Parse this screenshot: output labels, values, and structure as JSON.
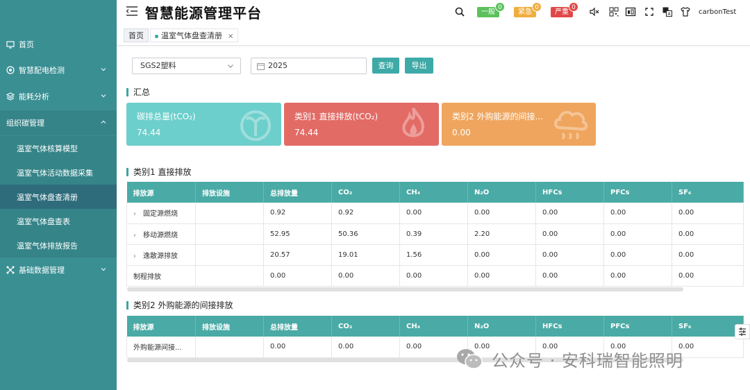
{
  "app": {
    "title": "智慧能源管理平台"
  },
  "sidebar": {
    "items": [
      {
        "label": "首页",
        "icon": "monitor-icon"
      },
      {
        "label": "智慧配电检测",
        "icon": "target-icon"
      },
      {
        "label": "能耗分析",
        "icon": "layers-icon"
      },
      {
        "label": "组织碳管理",
        "icon": ""
      },
      {
        "label": "基础数据管理",
        "icon": "network-icon"
      }
    ],
    "sub_items": [
      {
        "label": "温室气体核算模型"
      },
      {
        "label": "温室气体活动数据采集"
      },
      {
        "label": "温室气体盘查清册"
      },
      {
        "label": "温室气体盘查表"
      },
      {
        "label": "温室气体排放报告"
      }
    ]
  },
  "header": {
    "alerts": [
      {
        "label": "一般",
        "count": "0",
        "color": "#5cc15c"
      },
      {
        "label": "紧急",
        "count": "0",
        "color": "#f0ad3e"
      },
      {
        "label": "严重",
        "count": "0",
        "color": "#e04848"
      }
    ],
    "username": "carbonTest"
  },
  "tabs": [
    {
      "label": "首页"
    },
    {
      "label": "温室气体盘查清册",
      "close": "×"
    }
  ],
  "filters": {
    "org_value": "SGS2塑料",
    "year_value": "2025",
    "query_label": "查询",
    "export_label": "导出"
  },
  "summary": {
    "heading": "汇总",
    "cards": [
      {
        "title": "碳排总量(tCO₂)",
        "value": "74.44",
        "color": "#6dcfcb"
      },
      {
        "title": "类别1 直接排放(tCO₂)",
        "value": "74.44",
        "color": "#e36b66"
      },
      {
        "title": "类别2 外购能源的间接...",
        "value": "0.00",
        "color": "#efa55e"
      }
    ]
  },
  "cat1": {
    "heading": "类别1 直接排放",
    "headers": [
      "排放源",
      "排放设施",
      "总排放量",
      "CO₂",
      "CH₄",
      "N₂O",
      "HFCs",
      "PFCs",
      "SF₆"
    ],
    "rows": [
      {
        "cells": [
          "固定源燃烧",
          "",
          "0.92",
          "0.92",
          "0.00",
          "0.00",
          "0.00",
          "0.00",
          "0.00"
        ],
        "expandable": true
      },
      {
        "cells": [
          "移动源燃烧",
          "",
          "52.95",
          "50.36",
          "0.39",
          "2.20",
          "0.00",
          "0.00",
          "0.00"
        ],
        "expandable": true
      },
      {
        "cells": [
          "逸散源排放",
          "",
          "20.57",
          "19.01",
          "1.56",
          "0.00",
          "0.00",
          "0.00",
          "0.00"
        ],
        "expandable": true
      },
      {
        "cells": [
          "制程排放",
          "",
          "0.00",
          "0.00",
          "0.00",
          "0.00",
          "0.00",
          "0.00",
          "0.00"
        ],
        "expandable": false
      }
    ]
  },
  "cat2": {
    "heading": "类别2 外购能源的间接排放",
    "headers": [
      "排放源",
      "排放设施",
      "总排放量",
      "CO₂",
      "CH₄",
      "N₂O",
      "HFCs",
      "PFCs",
      "SF₆"
    ],
    "rows": [
      {
        "cells": [
          "外购能源间接...",
          "",
          "0.00",
          "0.00",
          "0.00",
          "0.00",
          "0.00",
          "0.00",
          "0.00"
        ],
        "expandable": false
      }
    ]
  },
  "watermark": {
    "text": "公众号 · 安科瑞智能照明"
  }
}
